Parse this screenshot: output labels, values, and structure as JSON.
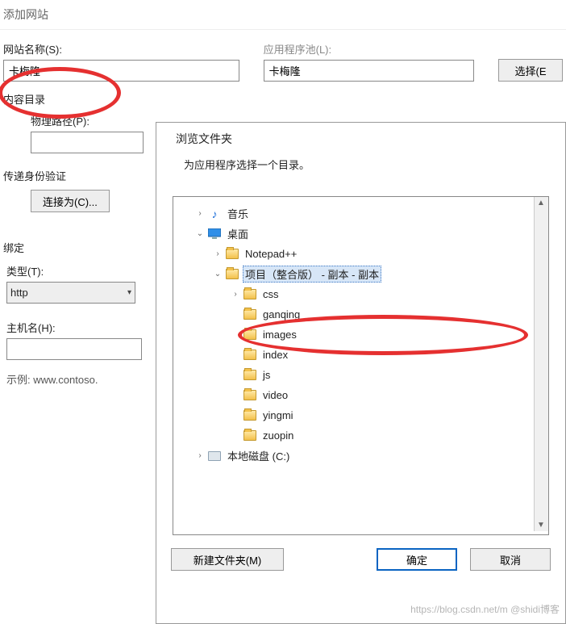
{
  "window": {
    "title": "添加网站"
  },
  "form": {
    "site_name_label": "网站名称(S):",
    "site_name_value": "卡梅隆",
    "app_pool_label": "应用程序池(L):",
    "app_pool_value": "卡梅隆",
    "select_btn": "选择(E",
    "content_dir_label": "内容目录",
    "physical_path_label": "物理路径(P):",
    "physical_path_value": "",
    "pass_auth_label": "传递身份验证",
    "connect_as_btn": "连接为(C)...",
    "binding_label": "绑定",
    "type_label": "类型(T):",
    "type_value": "http",
    "host_label": "主机名(H):",
    "host_value": "",
    "example_text": "示例: www.contoso."
  },
  "browse": {
    "title": "浏览文件夹",
    "instruction": "为应用程序选择一个目录。",
    "new_folder_btn": "新建文件夹(M)",
    "ok_btn": "确定",
    "cancel_btn": "取消",
    "tree": {
      "music": "音乐",
      "desktop": "桌面",
      "notepad": "Notepad++",
      "project": "项目（整合版） - 副本 - 副本",
      "css": "css",
      "ganqing": "ganqing",
      "images": "images",
      "index": "index",
      "js": "js",
      "video": "video",
      "yingmi": "yingmi",
      "zuopin": "zuopin",
      "drive_c": "本地磁盘 (C:)"
    }
  },
  "watermark": "https://blog.csdn.net/m @shidi博客"
}
